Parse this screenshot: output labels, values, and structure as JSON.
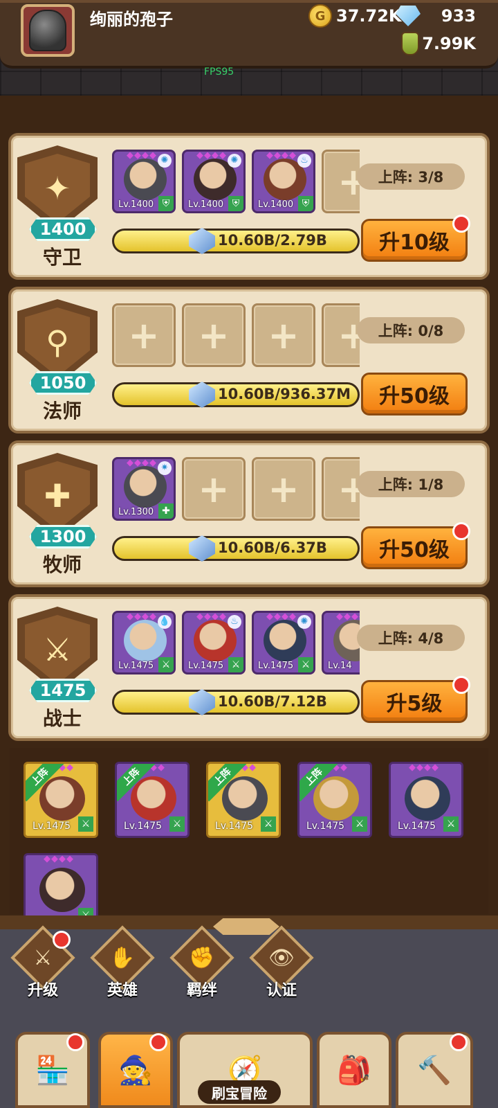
{
  "header": {
    "player_name": "绚丽的孢子",
    "gold": "37.72K",
    "gems": "933",
    "potion": "7.99K",
    "fps": "FPS95"
  },
  "classes": [
    {
      "key": "guard",
      "name": "守卫",
      "icon": "shield-icon",
      "level": "1400",
      "deploy": "上阵: 3/8",
      "progress_text": "10.60B/2.79B",
      "progress": 1.0,
      "upgrade_label": "升10级",
      "has_notice": true,
      "slots": [
        {
          "type": "hero",
          "level": "Lv.1400",
          "element": "wind",
          "tag": "shield"
        },
        {
          "type": "hero",
          "level": "Lv.1400",
          "element": "wind",
          "tag": "shield"
        },
        {
          "type": "hero",
          "level": "Lv.1400",
          "element": "fire",
          "tag": "shield"
        },
        {
          "type": "empty"
        }
      ]
    },
    {
      "key": "mage",
      "name": "法师",
      "icon": "staff-icon",
      "level": "1050",
      "deploy": "上阵: 0/8",
      "progress_text": "10.60B/936.37M",
      "progress": 1.0,
      "upgrade_label": "升50级",
      "has_notice": false,
      "slots": [
        {
          "type": "empty"
        },
        {
          "type": "empty"
        },
        {
          "type": "empty"
        },
        {
          "type": "empty"
        }
      ]
    },
    {
      "key": "priest",
      "name": "牧师",
      "icon": "cross-icon",
      "level": "1300",
      "deploy": "上阵: 1/8",
      "progress_text": "10.60B/6.37B",
      "progress": 1.0,
      "upgrade_label": "升50级",
      "has_notice": true,
      "slots": [
        {
          "type": "hero",
          "level": "Lv.1300",
          "element": "light",
          "tag": "cross"
        },
        {
          "type": "empty"
        },
        {
          "type": "empty"
        },
        {
          "type": "empty"
        }
      ]
    },
    {
      "key": "warrior",
      "name": "战士",
      "icon": "sword-icon",
      "level": "1475",
      "deploy": "上阵: 4/8",
      "progress_text": "10.60B/7.12B",
      "progress": 1.0,
      "upgrade_label": "升5级",
      "has_notice": true,
      "slots": [
        {
          "type": "hero",
          "level": "Lv.1475",
          "element": "water",
          "tag": "sword"
        },
        {
          "type": "hero",
          "level": "Lv.1475",
          "element": "fire",
          "tag": "sword"
        },
        {
          "type": "hero",
          "level": "Lv.1475",
          "element": "wind",
          "tag": "sword"
        },
        {
          "type": "hero",
          "level": "Lv.14",
          "element": "fire",
          "tag": "sword"
        }
      ]
    }
  ],
  "roster": {
    "deployed_label": "上阵",
    "cards": [
      {
        "level": "Lv.1475",
        "deployed": true,
        "rarity": "gold"
      },
      {
        "level": "Lv.1475",
        "deployed": true,
        "rarity": "purple"
      },
      {
        "level": "Lv.1475",
        "deployed": true,
        "rarity": "gold"
      },
      {
        "level": "Lv.1475",
        "deployed": true,
        "rarity": "purple"
      },
      {
        "level": "Lv.1475",
        "deployed": false,
        "rarity": "purple"
      },
      {
        "level": "",
        "deployed": false,
        "rarity": "purple"
      }
    ]
  },
  "subnav": [
    {
      "label": "升级",
      "icon": "sword-icon",
      "notice": true
    },
    {
      "label": "英雄",
      "icon": "hero-icon",
      "notice": false
    },
    {
      "label": "羁绊",
      "icon": "fist-icon",
      "notice": false
    },
    {
      "label": "认证",
      "icon": "eye-icon",
      "notice": false
    }
  ],
  "bottom_tabs": [
    {
      "icon": "shop-icon",
      "notice": true
    },
    {
      "icon": "hero-portrait-icon",
      "notice": true,
      "active": true
    },
    {
      "icon": "map-icon",
      "label": "刷宝冒险",
      "notice": false
    },
    {
      "icon": "backpack-icon",
      "notice": false
    },
    {
      "icon": "hammer-icon",
      "notice": true
    }
  ],
  "colors": {
    "accent_orange": "#f27d0f",
    "panel": "#efe1c6",
    "badge_teal": "#23a6a0",
    "notice_red": "#e8352e"
  }
}
